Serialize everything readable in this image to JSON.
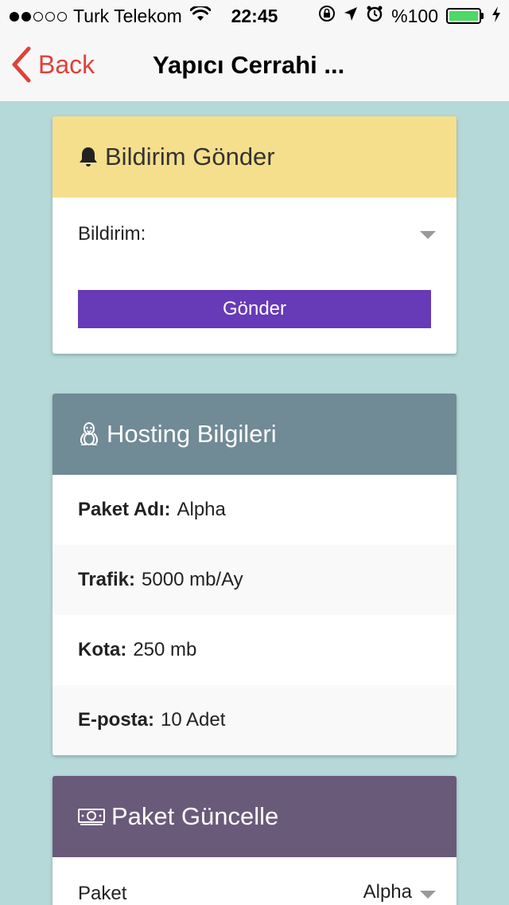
{
  "status_bar": {
    "carrier": "Turk Telekom",
    "time": "22:45",
    "battery": "%100",
    "signal_filled": 2,
    "signal_total": 5,
    "icons": [
      "wifi-icon",
      "rotation-lock-icon",
      "location-icon",
      "alarm-icon",
      "battery-icon",
      "charging-icon"
    ]
  },
  "nav": {
    "back_label": "Back",
    "title": "Yapıcı Cerrahi ..."
  },
  "notification_card": {
    "header": "Bildirim Gönder",
    "header_color": "#f5df8c",
    "icon": "bell-icon",
    "select_label": "Bildirim:",
    "button_label": "Gönder",
    "button_color": "#673ab7"
  },
  "hosting_card": {
    "header": "Hosting Bilgileri",
    "header_color": "#708a96",
    "icon": "linux-icon",
    "rows": [
      {
        "label": "Paket Adı:",
        "value": "Alpha"
      },
      {
        "label": "Trafik:",
        "value": "5000 mb/Ay"
      },
      {
        "label": "Kota:",
        "value": "250 mb"
      },
      {
        "label": "E-posta:",
        "value": "10 Adet"
      }
    ]
  },
  "package_card": {
    "header": "Paket Güncelle",
    "header_color": "#6a5a7a",
    "icon": "money-icon",
    "select_label": "Paket",
    "select_value": "Alpha"
  }
}
